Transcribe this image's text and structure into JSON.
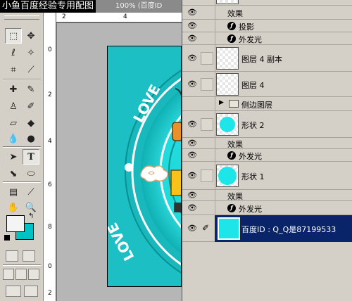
{
  "watermark": {
    "text": "小鱼百度经验专用配图"
  },
  "document": {
    "zoom": "100%",
    "title_text": "(百度ID"
  },
  "rulers": {
    "top": [
      "2",
      "4"
    ],
    "left": [
      "0",
      "2",
      "4",
      "6",
      "8",
      "0",
      "2"
    ]
  },
  "toolbox": {
    "tools": [
      "marquee",
      "move",
      "lasso",
      "magic-wand",
      "crop",
      "slice",
      "healing",
      "brush",
      "stamp",
      "history-brush",
      "eraser",
      "bucket",
      "blur",
      "dodge",
      "path-select",
      "type",
      "pen",
      "shape",
      "notes",
      "eyedropper",
      "hand",
      "zoom"
    ],
    "fg_color": "#f4f4f4",
    "bg_color": "#00c2c4"
  },
  "layers": {
    "fx_label": "效果",
    "rows": [
      {
        "kind": "effect",
        "name": "投影"
      },
      {
        "kind": "effect",
        "name": "外发光"
      },
      {
        "kind": "layer",
        "name": "图层 4 副本",
        "thumb": "checker"
      },
      {
        "kind": "layer",
        "name": "图层 4",
        "thumb": "checker"
      },
      {
        "kind": "group",
        "name": "侧边图层"
      },
      {
        "kind": "layer",
        "name": "形状 2",
        "thumb": "cyan"
      },
      {
        "kind": "effect",
        "name": "外发光"
      },
      {
        "kind": "layer",
        "name": "形状 1",
        "thumb": "cyan"
      },
      {
        "kind": "effect",
        "name": "外发光"
      },
      {
        "kind": "layer",
        "name": "百度ID : Q_Q是87199533",
        "thumb": "cyan-square",
        "selected": true
      }
    ]
  },
  "colors": {
    "canvas": "#1cc0c4",
    "selection": "#0a246a",
    "cyan": "#1ee6e8"
  }
}
